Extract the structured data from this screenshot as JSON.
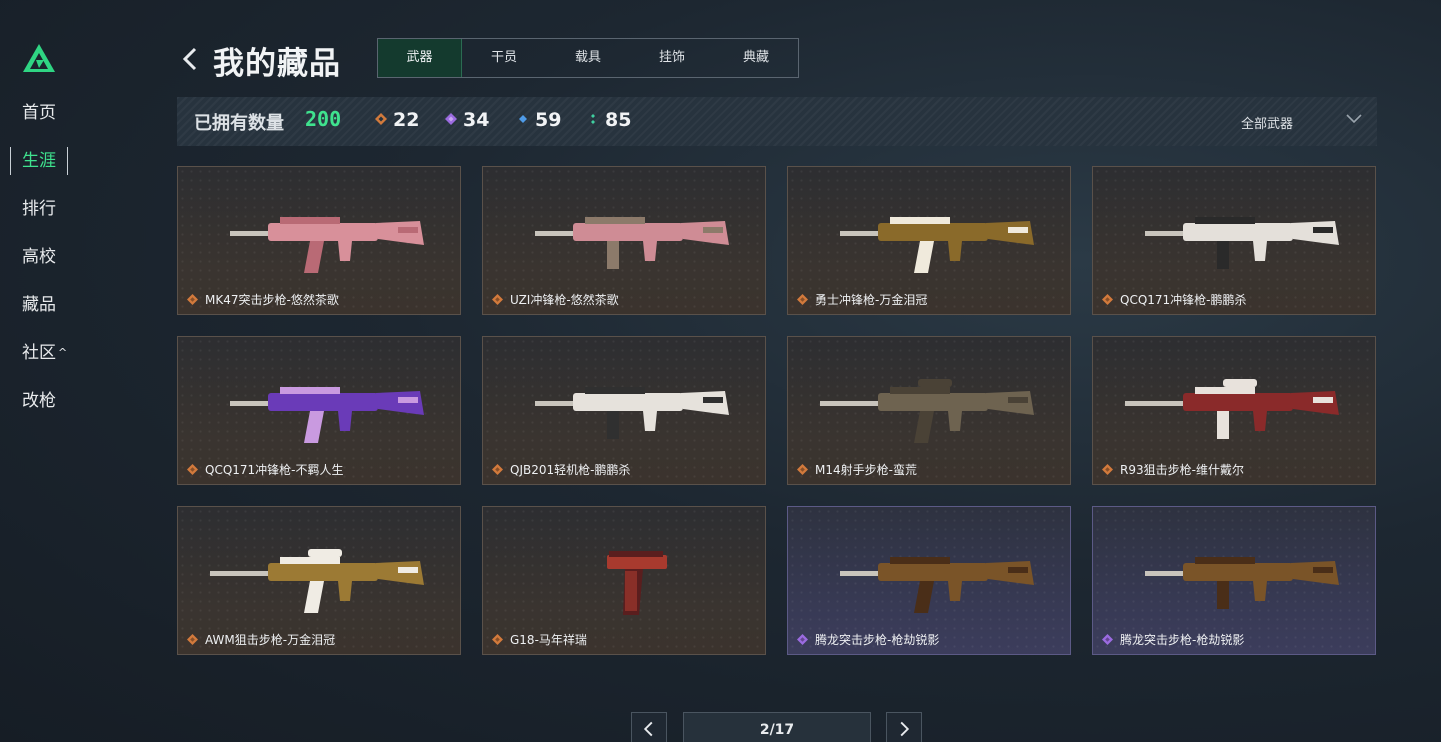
{
  "sidebar": {
    "items": [
      {
        "label": "首页"
      },
      {
        "label": "生涯"
      },
      {
        "label": "排行"
      },
      {
        "label": "高校"
      },
      {
        "label": "藏品"
      },
      {
        "label": "社区"
      },
      {
        "label": "改枪"
      }
    ],
    "active_index": 1
  },
  "header": {
    "title": "我的藏品",
    "tabs": [
      {
        "label": "武器"
      },
      {
        "label": "干员"
      },
      {
        "label": "载具"
      },
      {
        "label": "挂饰"
      },
      {
        "label": "典藏"
      }
    ],
    "active_tab": 0
  },
  "stats": {
    "owned_label": "已拥有数量",
    "owned_count": "200",
    "counts": [
      {
        "value": "22",
        "color": "#d27a3c",
        "icon": "orange-diamond-icon"
      },
      {
        "value": "34",
        "color": "#9b6be0",
        "icon": "purple-diamond-icon"
      },
      {
        "value": "59",
        "color": "#4f9be8",
        "icon": "blue-diamond-icon"
      },
      {
        "value": "85",
        "color": "#3fd0a0",
        "icon": "green-dots-icon"
      }
    ],
    "filter_label": "全部武器"
  },
  "items": [
    {
      "name": "MK47突击步枪-悠然茶歌",
      "rarity": "orange",
      "body": "#d8909a",
      "accent": "#b96a75"
    },
    {
      "name": "UZI冲锋枪-悠然茶歌",
      "rarity": "orange",
      "body": "#cf8c95",
      "accent": "#8c7a6a"
    },
    {
      "name": "勇士冲锋枪-万金泪冠",
      "rarity": "orange",
      "body": "#8a6a2a",
      "accent": "#f0eadc"
    },
    {
      "name": "QCQ171冲锋枪-鹏鹏杀",
      "rarity": "orange",
      "body": "#e4e0da",
      "accent": "#2a2a2a"
    },
    {
      "name": "QCQ171冲锋枪-不羁人生",
      "rarity": "orange",
      "body": "#6a3bb8",
      "accent": "#c99ae0"
    },
    {
      "name": "QJB201轻机枪-鹏鹏杀",
      "rarity": "orange",
      "body": "#e6e2dc",
      "accent": "#303030"
    },
    {
      "name": "M14射手步枪-蛮荒",
      "rarity": "orange",
      "body": "#6e6350",
      "accent": "#4a4236"
    },
    {
      "name": "R93狙击步枪-维什戴尔",
      "rarity": "orange",
      "body": "#8a2a2a",
      "accent": "#e8e2dc"
    },
    {
      "name": "AWM狙击步枪-万金泪冠",
      "rarity": "orange",
      "body": "#9c7a34",
      "accent": "#f0ece4"
    },
    {
      "name": "G18-马年祥瑞",
      "rarity": "orange",
      "body": "#a83a2e",
      "accent": "#5a1e1e"
    },
    {
      "name": "腾龙突击步枪-枪劫锐影",
      "rarity": "purple",
      "body": "#7a5428",
      "accent": "#4a2e18"
    },
    {
      "name": "腾龙突击步枪-枪劫锐影",
      "rarity": "purple",
      "body": "#7a5428",
      "accent": "#4a2e18"
    }
  ],
  "rarity_colors": {
    "orange": "#d27a3c",
    "purple": "#9b6be0"
  },
  "pagination": {
    "current": "2/17",
    "prev_icon": "chevron-left-icon",
    "next_icon": "chevron-right-icon"
  }
}
